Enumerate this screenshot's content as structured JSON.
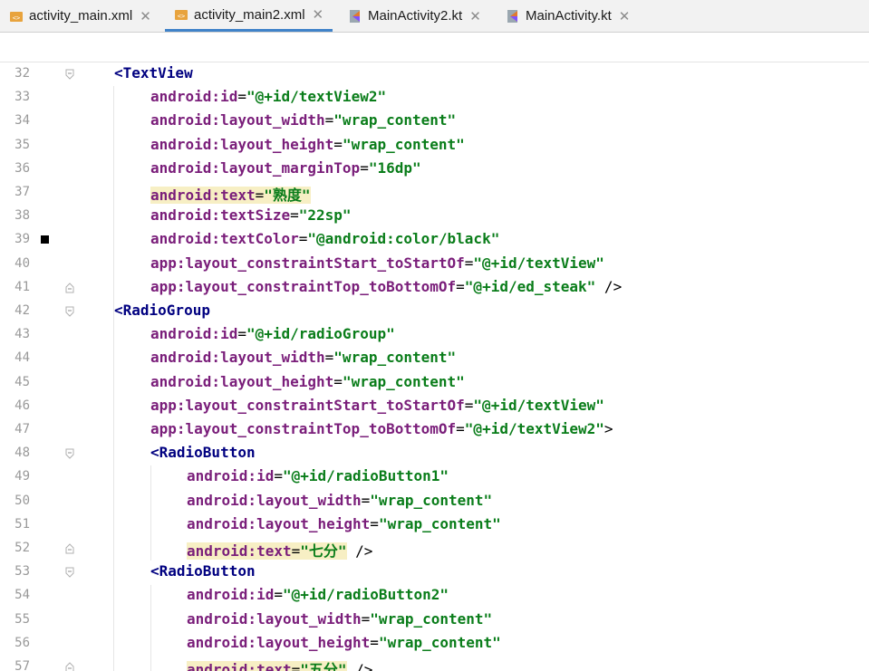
{
  "tabs": [
    {
      "label": "activity_main.xml",
      "active": false
    },
    {
      "label": "activity_main2.xml",
      "active": true
    },
    {
      "label": "MainActivity2.kt",
      "active": false
    },
    {
      "label": "MainActivity.kt",
      "active": false
    }
  ],
  "lines": [
    {
      "num": "32",
      "parts": [
        {
          "t": "<TextView",
          "c": "tag"
        }
      ]
    },
    {
      "num": "33",
      "parts": [
        {
          "t": "android:id",
          "c": "attr"
        },
        {
          "t": "=",
          "c": "eq"
        },
        {
          "t": "\"@+id/textView2\"",
          "c": "val"
        }
      ]
    },
    {
      "num": "34",
      "parts": [
        {
          "t": "android:layout_width",
          "c": "attr"
        },
        {
          "t": "=",
          "c": "eq"
        },
        {
          "t": "\"wrap_content\"",
          "c": "val"
        }
      ]
    },
    {
      "num": "35",
      "parts": [
        {
          "t": "android:layout_height",
          "c": "attr"
        },
        {
          "t": "=",
          "c": "eq"
        },
        {
          "t": "\"wrap_content\"",
          "c": "val"
        }
      ]
    },
    {
      "num": "36",
      "parts": [
        {
          "t": "android:layout_marginTop",
          "c": "attr"
        },
        {
          "t": "=",
          "c": "eq"
        },
        {
          "t": "\"16dp\"",
          "c": "val"
        }
      ]
    },
    {
      "num": "37",
      "parts": [
        {
          "t": "android:text",
          "c": "attr hl"
        },
        {
          "t": "=",
          "c": "eq hl"
        },
        {
          "t": "\"熟度\"",
          "c": "val hl"
        }
      ]
    },
    {
      "num": "38",
      "parts": [
        {
          "t": "android:textSize",
          "c": "attr"
        },
        {
          "t": "=",
          "c": "eq"
        },
        {
          "t": "\"22sp\"",
          "c": "val"
        }
      ]
    },
    {
      "num": "39",
      "parts": [
        {
          "t": "android:textColor",
          "c": "attr"
        },
        {
          "t": "=",
          "c": "eq"
        },
        {
          "t": "\"@android:color/black\"",
          "c": "val"
        }
      ]
    },
    {
      "num": "40",
      "parts": [
        {
          "t": "app:layout_constraintStart_toStartOf",
          "c": "attr"
        },
        {
          "t": "=",
          "c": "eq"
        },
        {
          "t": "\"@+id/textView\"",
          "c": "val"
        }
      ]
    },
    {
      "num": "41",
      "parts": [
        {
          "t": "app:layout_constraintTop_toBottomOf",
          "c": "attr"
        },
        {
          "t": "=",
          "c": "eq"
        },
        {
          "t": "\"@+id/ed_steak\"",
          "c": "val"
        },
        {
          "t": " />",
          "c": "plain"
        }
      ]
    },
    {
      "num": "42",
      "parts": [
        {
          "t": "<RadioGroup",
          "c": "tag"
        }
      ]
    },
    {
      "num": "43",
      "parts": [
        {
          "t": "android:id",
          "c": "attr"
        },
        {
          "t": "=",
          "c": "eq"
        },
        {
          "t": "\"@+id/radioGroup\"",
          "c": "val"
        }
      ]
    },
    {
      "num": "44",
      "parts": [
        {
          "t": "android:layout_width",
          "c": "attr"
        },
        {
          "t": "=",
          "c": "eq"
        },
        {
          "t": "\"wrap_content\"",
          "c": "val"
        }
      ]
    },
    {
      "num": "45",
      "parts": [
        {
          "t": "android:layout_height",
          "c": "attr"
        },
        {
          "t": "=",
          "c": "eq"
        },
        {
          "t": "\"wrap_content\"",
          "c": "val"
        }
      ]
    },
    {
      "num": "46",
      "parts": [
        {
          "t": "app:layout_constraintStart_toStartOf",
          "c": "attr"
        },
        {
          "t": "=",
          "c": "eq"
        },
        {
          "t": "\"@+id/textView\"",
          "c": "val"
        }
      ]
    },
    {
      "num": "47",
      "parts": [
        {
          "t": "app:layout_constraintTop_toBottomOf",
          "c": "attr"
        },
        {
          "t": "=",
          "c": "eq"
        },
        {
          "t": "\"@+id/textView2\"",
          "c": "val"
        },
        {
          "t": ">",
          "c": "plain"
        }
      ]
    },
    {
      "num": "48",
      "parts": [
        {
          "t": "<RadioButton",
          "c": "tag"
        }
      ]
    },
    {
      "num": "49",
      "parts": [
        {
          "t": "android:id",
          "c": "attr"
        },
        {
          "t": "=",
          "c": "eq"
        },
        {
          "t": "\"@+id/radioButton1\"",
          "c": "val"
        }
      ]
    },
    {
      "num": "50",
      "parts": [
        {
          "t": "android:layout_width",
          "c": "attr"
        },
        {
          "t": "=",
          "c": "eq"
        },
        {
          "t": "\"wrap_content\"",
          "c": "val"
        }
      ]
    },
    {
      "num": "51",
      "parts": [
        {
          "t": "android:layout_height",
          "c": "attr"
        },
        {
          "t": "=",
          "c": "eq"
        },
        {
          "t": "\"wrap_content\"",
          "c": "val"
        }
      ]
    },
    {
      "num": "52",
      "parts": [
        {
          "t": "android:text",
          "c": "attr hl"
        },
        {
          "t": "=",
          "c": "eq hl"
        },
        {
          "t": "\"七分\"",
          "c": "val hl"
        },
        {
          "t": " />",
          "c": "plain"
        }
      ]
    },
    {
      "num": "53",
      "parts": [
        {
          "t": "<RadioButton",
          "c": "tag"
        }
      ]
    },
    {
      "num": "54",
      "parts": [
        {
          "t": "android:id",
          "c": "attr"
        },
        {
          "t": "=",
          "c": "eq"
        },
        {
          "t": "\"@+id/radioButton2\"",
          "c": "val"
        }
      ]
    },
    {
      "num": "55",
      "parts": [
        {
          "t": "android:layout_width",
          "c": "attr"
        },
        {
          "t": "=",
          "c": "eq"
        },
        {
          "t": "\"wrap_content\"",
          "c": "val"
        }
      ]
    },
    {
      "num": "56",
      "parts": [
        {
          "t": "android:layout_height",
          "c": "attr"
        },
        {
          "t": "=",
          "c": "eq"
        },
        {
          "t": "\"wrap_content\"",
          "c": "val"
        }
      ]
    },
    {
      "num": "57",
      "parts": [
        {
          "t": "android:text",
          "c": "attr hl"
        },
        {
          "t": "=",
          "c": "eq hl"
        },
        {
          "t": "\"五分\"",
          "c": "val hl"
        },
        {
          "t": " />",
          "c": "plain"
        }
      ]
    }
  ]
}
